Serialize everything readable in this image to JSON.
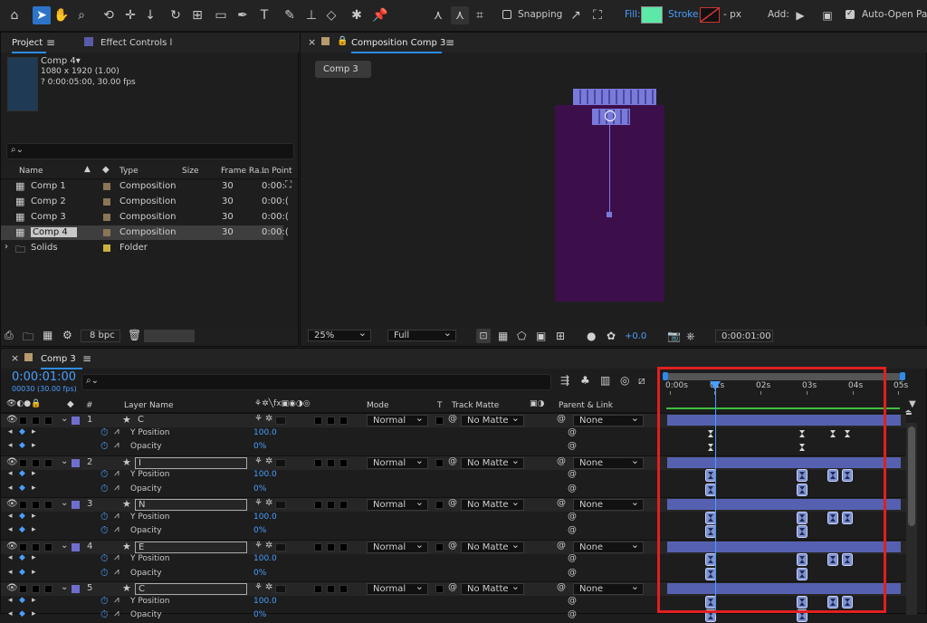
{
  "toolbar": {
    "snapping_label": "Snapping",
    "fill_label": "Fill:",
    "stroke_label": "Stroke:",
    "stroke_px": "- px",
    "add_label": "Add:",
    "auto_open_label": "Auto-Open Pane",
    "fill_color": "#5ee8a8"
  },
  "project_panel": {
    "tab_project": "Project",
    "tab_effect_controls": "Effect Controls l",
    "selected_name": "Comp 4▾",
    "selected_dims": "1080 x 1920 (1.00)",
    "selected_duration": "? 0:00:05:00, 30.00 fps",
    "search_placeholder": "",
    "columns": {
      "name": "Name",
      "type": "Type",
      "size": "Size",
      "frame_rate": "Frame Ra...",
      "in_point": "In Point"
    },
    "items": [
      {
        "name": "Comp 1",
        "type": "Composition",
        "frame_rate": "30",
        "in_point": "0:00:"
      },
      {
        "name": "Comp 2",
        "type": "Composition",
        "frame_rate": "30",
        "in_point": "0:00:("
      },
      {
        "name": "Comp 3",
        "type": "Composition",
        "frame_rate": "30",
        "in_point": "0:00:("
      },
      {
        "name": "Comp 4",
        "type": "Composition",
        "frame_rate": "30",
        "in_point": "0:00:("
      },
      {
        "name": "Solids",
        "type": "Folder",
        "frame_rate": "",
        "in_point": ""
      }
    ],
    "bpc": "8 bpc"
  },
  "composition_panel": {
    "tab_title": "Composition Comp 3",
    "comp_tab": "Comp 3",
    "zoom": "25%",
    "resolution": "Full",
    "exposure": "+0.0",
    "timecode": "0:00:01:00"
  },
  "timeline": {
    "tab_title": "Comp 3",
    "current_time": "0:00:01:00",
    "frame_info": "00030 (30.00 fps)",
    "headers": {
      "layer_name": "Layer Name",
      "mode": "Mode",
      "t": "T",
      "track_matte": "Track Matte",
      "parent": "Parent & Link"
    },
    "ruler": [
      "0:00s",
      "01s",
      "02s",
      "03s",
      "04s",
      "05s"
    ],
    "layers": [
      {
        "num": "1",
        "name": "C",
        "mode": "Normal",
        "matte": "No Matte",
        "parent": "None",
        "y_position": "100.0",
        "opacity": "0%"
      },
      {
        "num": "2",
        "name": "I",
        "mode": "Normal",
        "matte": "No Matte",
        "parent": "None",
        "y_position": "100.0",
        "opacity": "0%"
      },
      {
        "num": "3",
        "name": "N",
        "mode": "Normal",
        "matte": "No Matte",
        "parent": "None",
        "y_position": "100.0",
        "opacity": "0%"
      },
      {
        "num": "4",
        "name": "E",
        "mode": "Normal",
        "matte": "No Matte",
        "parent": "None",
        "y_position": "100.0",
        "opacity": "0%"
      },
      {
        "num": "5",
        "name": "C",
        "mode": "Normal",
        "matte": "No Matte",
        "parent": "None",
        "y_position": "100.0",
        "opacity": "0%"
      }
    ],
    "property_labels": {
      "y_position": "Y Position",
      "opacity": "Opacity"
    }
  },
  "colors": {
    "accent": "#2d8ceb",
    "layer_label": "#6e6ecf",
    "layer_bar": "#5561b0",
    "comp_bg": "#3d0f4a",
    "highlight_box": "#e02020",
    "work_area": "#3dbf3d"
  }
}
